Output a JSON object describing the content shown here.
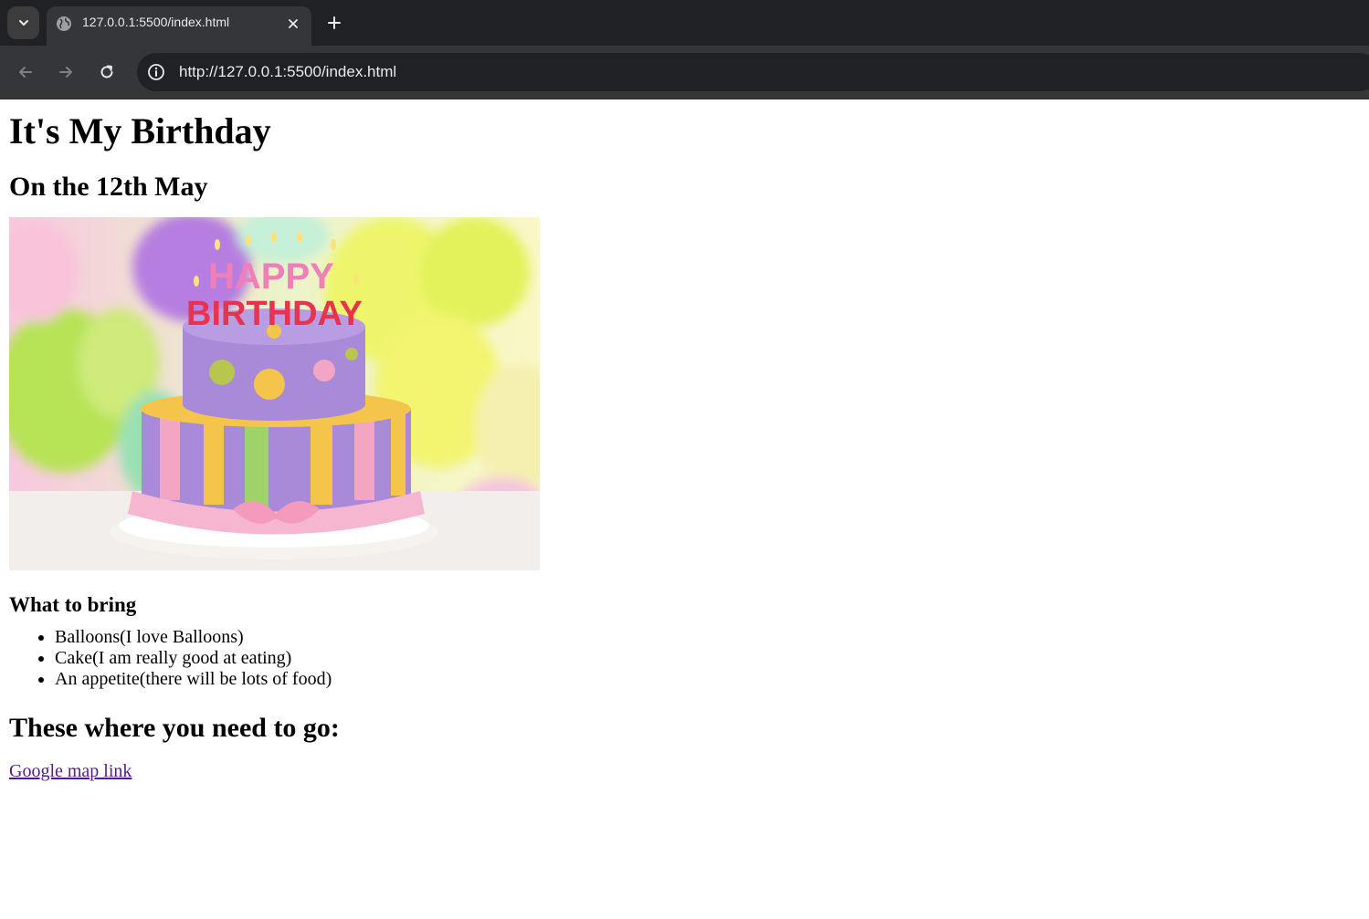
{
  "browser": {
    "tab_title": "127.0.0.1:5500/index.html",
    "url": "http://127.0.0.1:5500/index.html",
    "icons": [
      "chevron-down-icon",
      "globe-icon",
      "close-icon",
      "plus-icon",
      "back-arrow-icon",
      "forward-arrow-icon",
      "reload-icon",
      "info-icon"
    ]
  },
  "page": {
    "title": "It's My Birthday",
    "subtitle": "On the 12th May",
    "image_caption_text": {
      "top": "HAPPY",
      "bottom": "BIRTHDAY"
    },
    "bring_heading": "What to bring",
    "bring_items": [
      "Balloons(I love Balloons)",
      "Cake(I am really good at eating)",
      "An appetite(there will be lots of food)"
    ],
    "where_heading": "These where you need to go:",
    "link_text": "Google map link",
    "link_color": "#551a8b"
  }
}
